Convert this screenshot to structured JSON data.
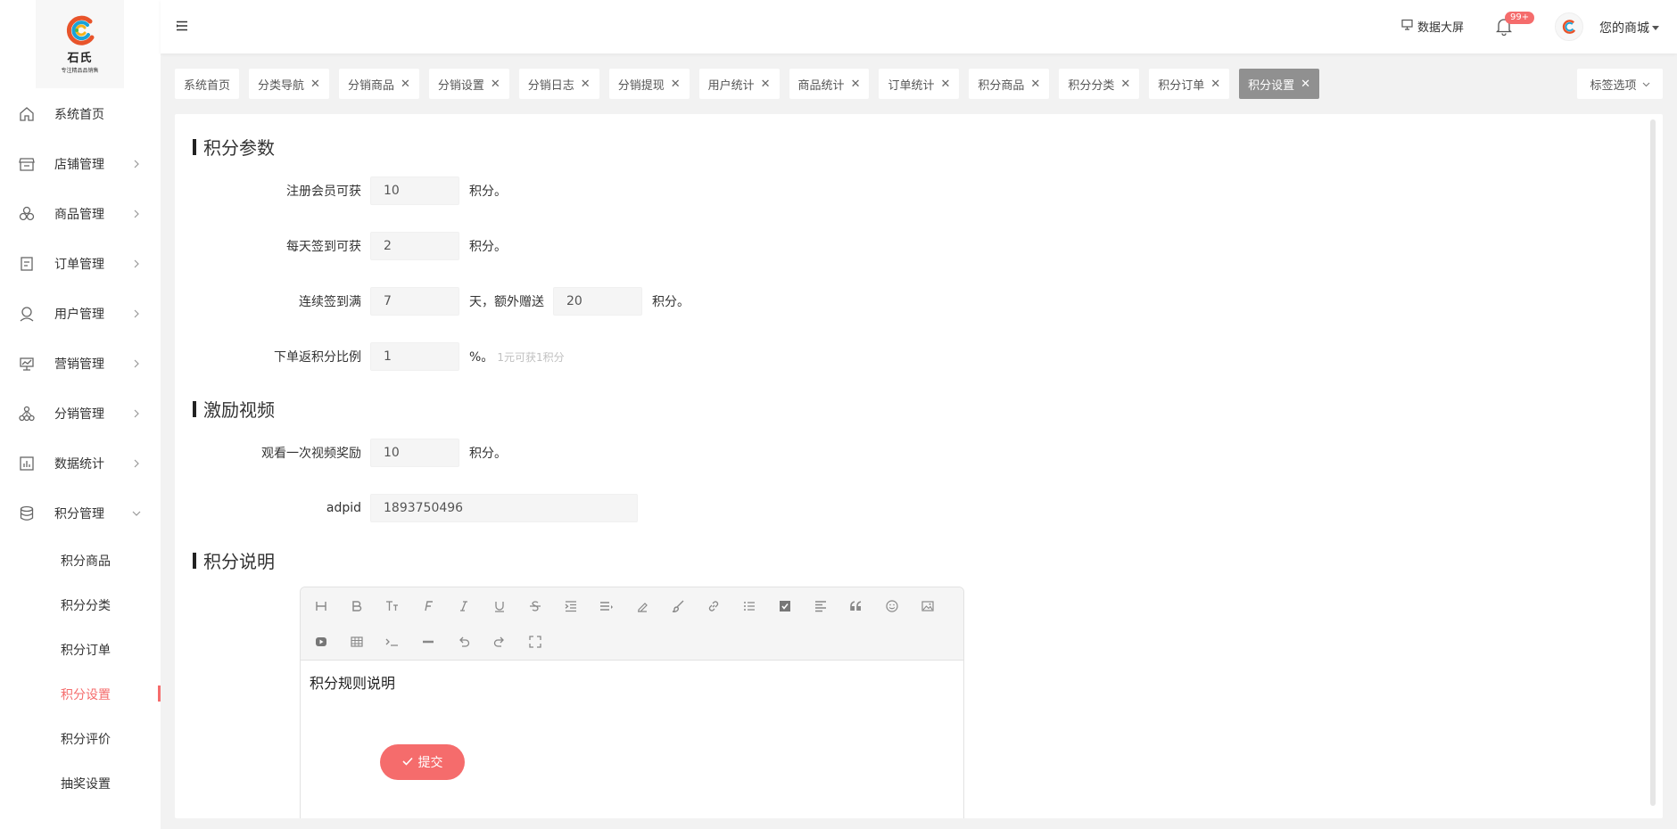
{
  "brand": {
    "name": "石氏",
    "slogan": "专注精品品销售"
  },
  "sidebar": {
    "items": [
      {
        "label": "系统首页",
        "icon": "home-icon",
        "arrow": false
      },
      {
        "label": "店铺管理",
        "icon": "shop-icon",
        "arrow": true
      },
      {
        "label": "商品管理",
        "icon": "goods-icon",
        "arrow": true
      },
      {
        "label": "订单管理",
        "icon": "order-icon",
        "arrow": true
      },
      {
        "label": "用户管理",
        "icon": "user-icon",
        "arrow": true
      },
      {
        "label": "营销管理",
        "icon": "marketing-icon",
        "arrow": true
      },
      {
        "label": "分销管理",
        "icon": "distribution-icon",
        "arrow": true
      },
      {
        "label": "数据统计",
        "icon": "chart-icon",
        "arrow": true
      },
      {
        "label": "积分管理",
        "icon": "database-icon",
        "arrow": true,
        "expanded": true
      }
    ],
    "sub_items": [
      {
        "label": "积分商品",
        "active": false
      },
      {
        "label": "积分分类",
        "active": false
      },
      {
        "label": "积分订单",
        "active": false
      },
      {
        "label": "积分设置",
        "active": true
      },
      {
        "label": "积分评价",
        "active": false
      },
      {
        "label": "抽奖设置",
        "active": false
      }
    ],
    "active_color": "#f56c6c"
  },
  "header": {
    "screen_label": "数据大屏",
    "badge": "99+",
    "user": "您的商城"
  },
  "tags": [
    {
      "label": "系统首页",
      "closable": false
    },
    {
      "label": "分类导航",
      "closable": true
    },
    {
      "label": "分销商品",
      "closable": true
    },
    {
      "label": "分销设置",
      "closable": true
    },
    {
      "label": "分销日志",
      "closable": true
    },
    {
      "label": "分销提现",
      "closable": true
    },
    {
      "label": "用户统计",
      "closable": true
    },
    {
      "label": "商品统计",
      "closable": true
    },
    {
      "label": "订单统计",
      "closable": true
    },
    {
      "label": "积分商品",
      "closable": true
    },
    {
      "label": "积分分类",
      "closable": true
    },
    {
      "label": "积分订单",
      "closable": true
    },
    {
      "label": "积分设置",
      "closable": true,
      "active": true
    }
  ],
  "tag_options_label": "标签选项",
  "form": {
    "section1": "积分参数",
    "register": {
      "label": "注册会员可获",
      "value": "10",
      "unit": "积分。"
    },
    "signin": {
      "label": "每天签到可获",
      "value": "2",
      "unit": "积分。"
    },
    "continuous": {
      "label": "连续签到满",
      "days": "7",
      "mid": "天，额外赠送",
      "bonus": "20",
      "unit": "积分。"
    },
    "rebate": {
      "label": "下单返积分比例",
      "value": "1",
      "unit": "%。",
      "hint": "1元可获1积分"
    },
    "section2": "激励视频",
    "video": {
      "label": "观看一次视频奖励",
      "value": "10",
      "unit": "积分。"
    },
    "adpid": {
      "label": "adpid",
      "value": "1893750496"
    },
    "section3": "积分说明",
    "editor_content": "积分规则说明",
    "submit_label": "提交"
  }
}
